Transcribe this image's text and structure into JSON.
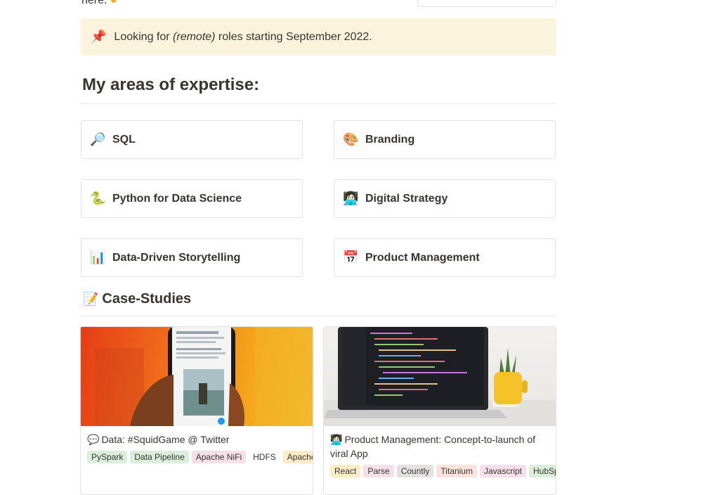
{
  "top_text": "here.",
  "callout": {
    "icon": "pushpin-icon",
    "emoji": "📌",
    "text_before": "Looking for ",
    "text_italic": "(remote)",
    "text_after": " roles starting September 2022."
  },
  "expertise": {
    "heading": "My areas of expertise:",
    "items": [
      {
        "emoji": "🔎",
        "icon": "magnifying-glass-icon",
        "label": "SQL"
      },
      {
        "emoji": "🎨",
        "icon": "palette-icon",
        "label": "Branding"
      },
      {
        "emoji": "🐍",
        "icon": "snake-icon",
        "label": "Python for Data Science"
      },
      {
        "emoji": "👩🏻‍💻",
        "icon": "technologist-icon",
        "label": "Digital Strategy"
      },
      {
        "emoji": "📊",
        "icon": "bar-chart-icon",
        "label": "Data-Driven Storytelling"
      },
      {
        "emoji": "📅",
        "icon": "calendar-icon",
        "label": "Product Management"
      }
    ]
  },
  "case_studies": {
    "emoji": "📝",
    "icon": "memo-icon",
    "heading": "Case-Studies",
    "cards": [
      {
        "emoji": "💬",
        "icon": "speech-bubble-icon",
        "title": "Data: #SquidGame @ Twitter",
        "tags": [
          "PySpark",
          "Data Pipeline",
          "Apache NiFi",
          "HDFS",
          "Apache"
        ],
        "tag_colors": [
          "#dbeddb",
          "#dbeddb",
          "#f5e0e9",
          "#ffffff",
          "#fdecc8"
        ]
      },
      {
        "emoji": "👩🏻‍💻",
        "icon": "technologist-icon",
        "title": "Product Management: Concept-to-launch of viral App",
        "tags": [
          "React",
          "Parse",
          "Countly",
          "Titanium",
          "Javascript",
          "HubSpot"
        ],
        "tag_colors": [
          "#fdecc8",
          "#f5e0e9",
          "#e3e2e0",
          "#ffe2dd",
          "#f5e0e9",
          "#dbeddb"
        ]
      }
    ]
  }
}
